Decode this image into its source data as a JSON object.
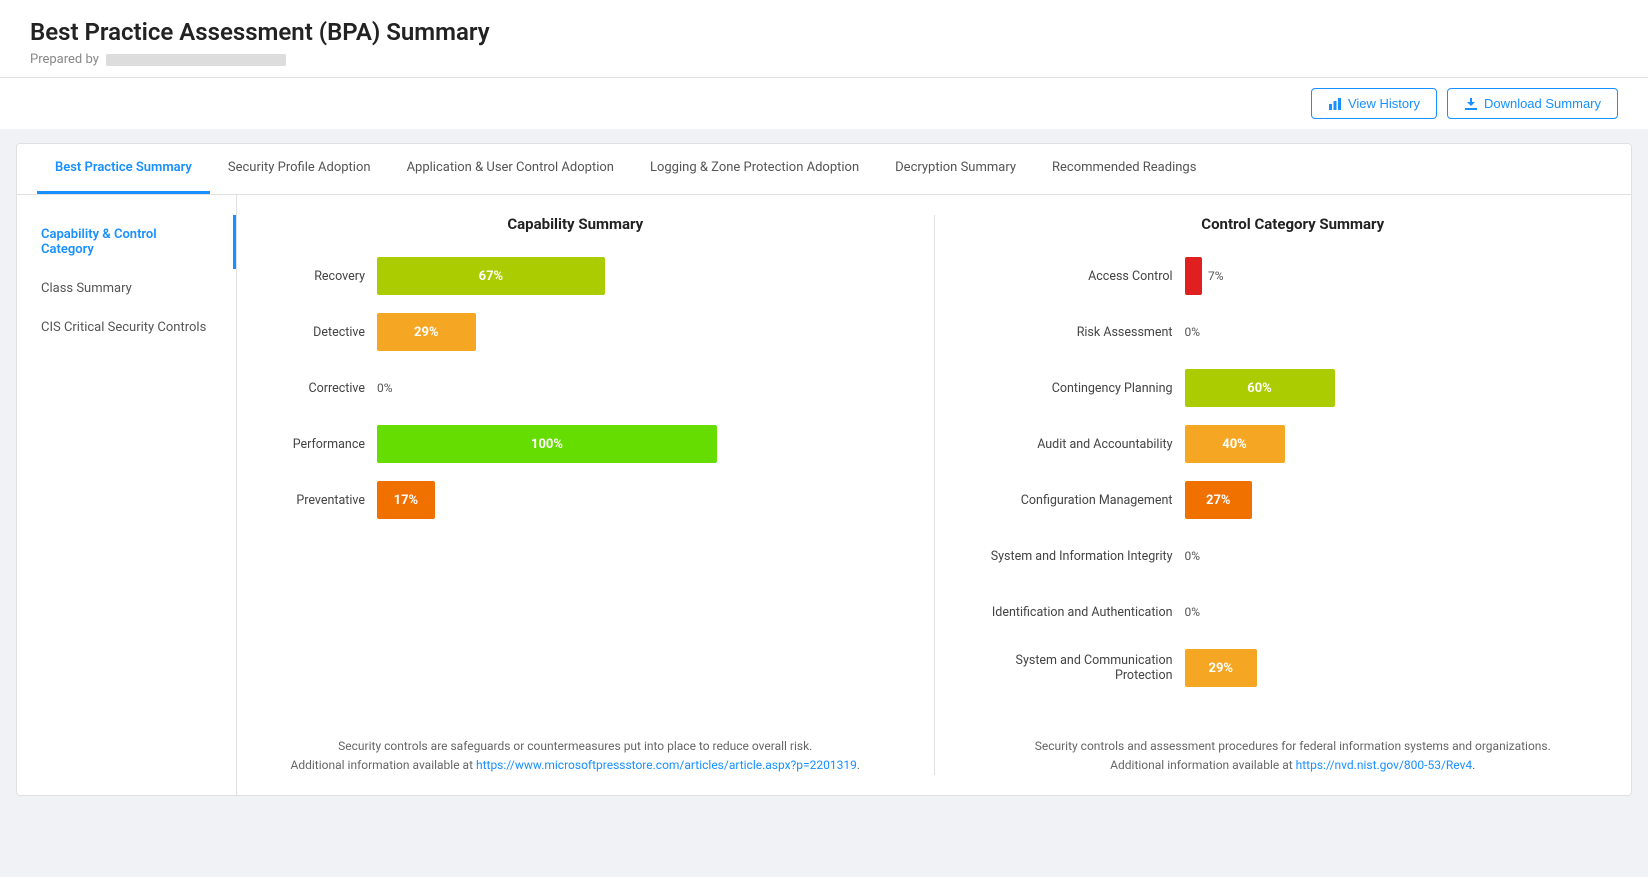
{
  "header": {
    "title": "Best Practice Assessment (BPA) Summary",
    "prepared_by_label": "Prepared by"
  },
  "actions": {
    "view_history": "View History",
    "download_summary": "Download Summary"
  },
  "tabs": [
    {
      "label": "Best Practice Summary",
      "active": true
    },
    {
      "label": "Security Profile Adoption",
      "active": false
    },
    {
      "label": "Application & User Control Adoption",
      "active": false
    },
    {
      "label": "Logging & Zone Protection Adoption",
      "active": false
    },
    {
      "label": "Decryption Summary",
      "active": false
    },
    {
      "label": "Recommended Readings",
      "active": false
    }
  ],
  "sidebar": {
    "items": [
      {
        "label": "Capability & Control Category",
        "active": true
      },
      {
        "label": "Class Summary",
        "active": false
      },
      {
        "label": "CIS Critical Security Controls",
        "active": false
      }
    ]
  },
  "capability_chart": {
    "title": "Capability Summary",
    "bars": [
      {
        "label": "Recovery",
        "value": 67,
        "color": "#aacc00",
        "show_label_inside": true
      },
      {
        "label": "Detective",
        "value": 29,
        "color": "#f5a623",
        "show_label_inside": true
      },
      {
        "label": "Corrective",
        "value": 0,
        "color": null,
        "show_label_inside": false
      },
      {
        "label": "Performance",
        "value": 100,
        "color": "#66dd00",
        "show_label_inside": true
      },
      {
        "label": "Preventative",
        "value": 17,
        "color": "#f07000",
        "show_label_inside": true
      }
    ],
    "max_width": 340,
    "footnote_text": "Security controls are safeguards or countermeasures put into place to reduce overall risk.\nAdditional information available at ",
    "footnote_link_text": "https://www.microsoftpressstore.com/articles/article.aspx?p=2201319",
    "footnote_link": "https://www.microsoftpressstore.com/articles/article.aspx?p=2201319"
  },
  "control_chart": {
    "title": "Control Category Summary",
    "bars": [
      {
        "label": "Access Control",
        "value": 7,
        "color": "#e02020",
        "show_label_inside": false
      },
      {
        "label": "Risk Assessment",
        "value": 0,
        "color": null,
        "show_label_inside": false
      },
      {
        "label": "Contingency Planning",
        "value": 60,
        "color": "#aacc00",
        "show_label_inside": true
      },
      {
        "label": "Audit and Accountability",
        "value": 40,
        "color": "#f5a623",
        "show_label_inside": true
      },
      {
        "label": "Configuration Management",
        "value": 27,
        "color": "#f07000",
        "show_label_inside": true
      },
      {
        "label": "System and Information Integrity",
        "value": 0,
        "color": null,
        "show_label_inside": false
      },
      {
        "label": "Identification and Authentication",
        "value": 0,
        "color": null,
        "show_label_inside": false
      },
      {
        "label": "System and Communication Protection",
        "value": 29,
        "color": "#f5a623",
        "show_label_inside": true
      }
    ],
    "max_width": 250,
    "footnote_text": "Security controls and assessment procedures for federal information systems and organizations.\nAdditional information available at ",
    "footnote_link_text": "https://nvd.nist.gov/800-53/Rev4",
    "footnote_link": "https://nvd.nist.gov/800-53/Rev4"
  }
}
